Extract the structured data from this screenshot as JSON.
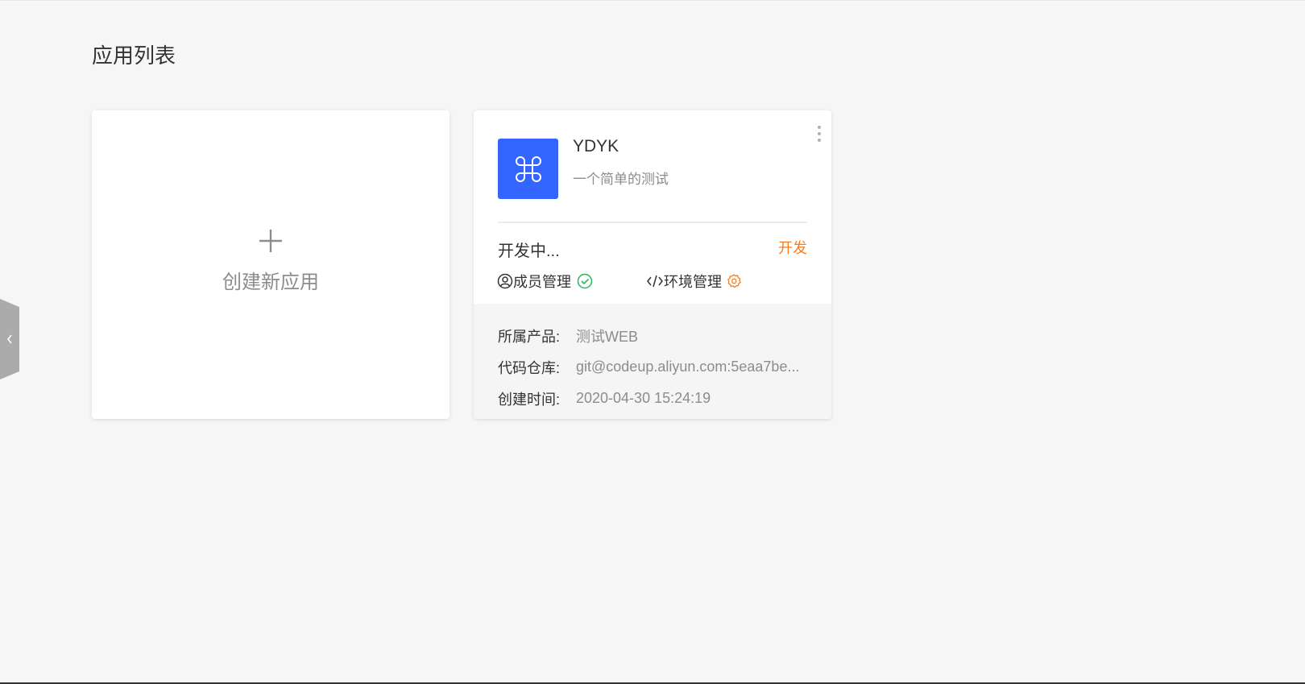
{
  "page": {
    "title": "应用列表"
  },
  "create_card": {
    "label": "创建新应用"
  },
  "app_card": {
    "name": "YDYK",
    "description": "一个简单的测试",
    "status": "开发中...",
    "action_label": "开发",
    "members_label": "成员管理",
    "env_label": "环境管理",
    "info": [
      {
        "label": "所属产品:",
        "value": "测试WEB"
      },
      {
        "label": "代码仓库:",
        "value": "git@codeup.aliyun.com:5eaa7be..."
      },
      {
        "label": "创建时间:",
        "value": "2020-04-30 15:24:19"
      }
    ]
  },
  "colors": {
    "app_icon_bg": "#3366ff",
    "accent_orange": "#f77b1f",
    "success_green": "#2db55d"
  },
  "icons": {
    "side_toggle": "chevron-left-icon",
    "create": "plus-icon",
    "app": "command-icon",
    "more": "more-vertical-icon",
    "members": "user-circle-icon",
    "members_status": "check-circle-icon",
    "env": "code-icon",
    "env_status": "gear-icon"
  }
}
